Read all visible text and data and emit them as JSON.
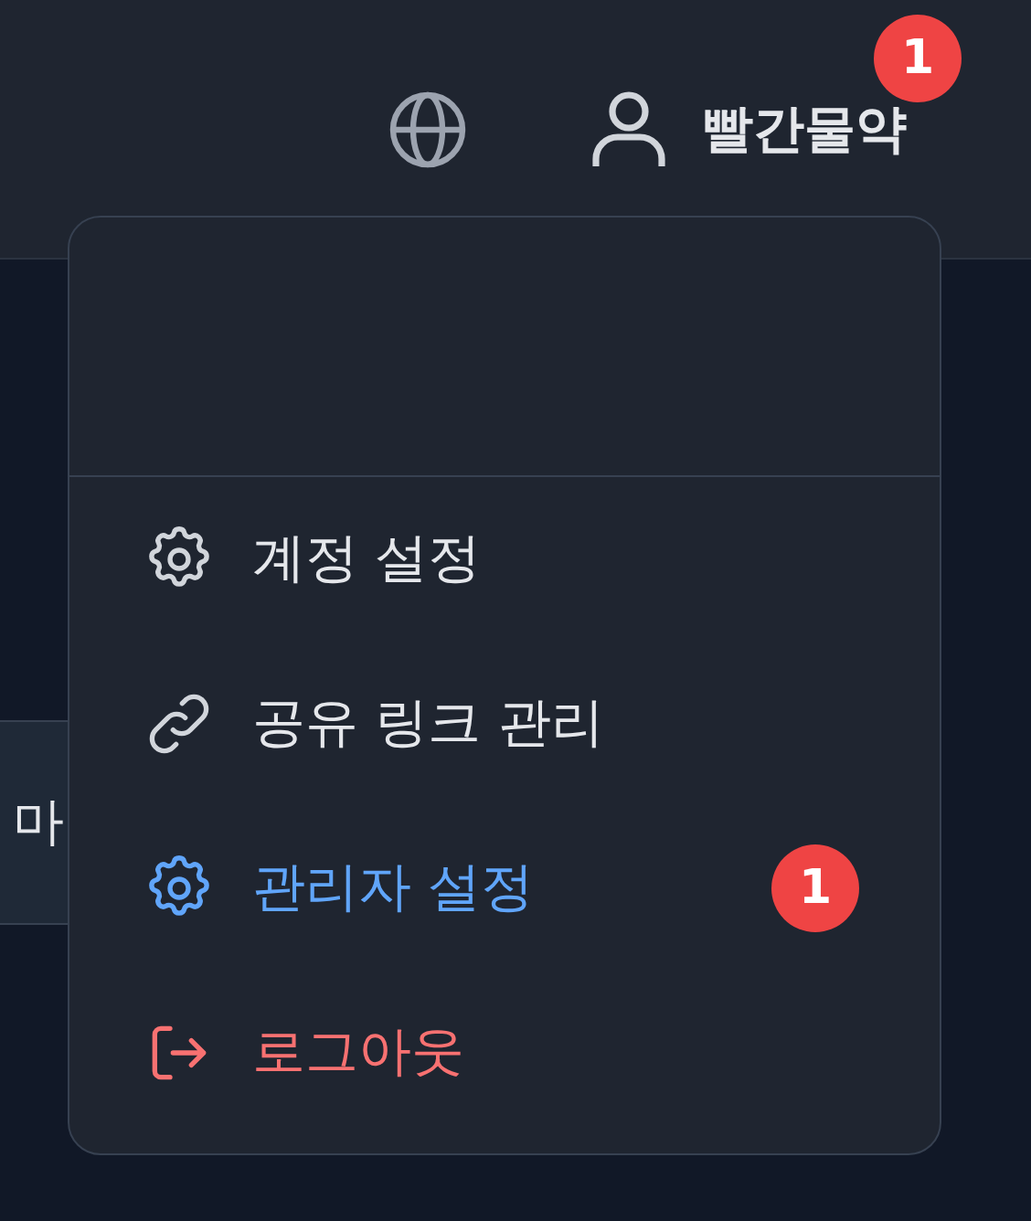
{
  "header": {
    "user_name": "빨간물약",
    "notification_badge": "1"
  },
  "background_card": {
    "text": "마"
  },
  "menu": {
    "items": [
      {
        "label": "계정 설정",
        "kind": "settings"
      },
      {
        "label": "공유 링크 관리",
        "kind": "link"
      },
      {
        "label": "관리자 설정",
        "kind": "admin",
        "badge": "1"
      },
      {
        "label": "로그아웃",
        "kind": "logout"
      }
    ]
  }
}
